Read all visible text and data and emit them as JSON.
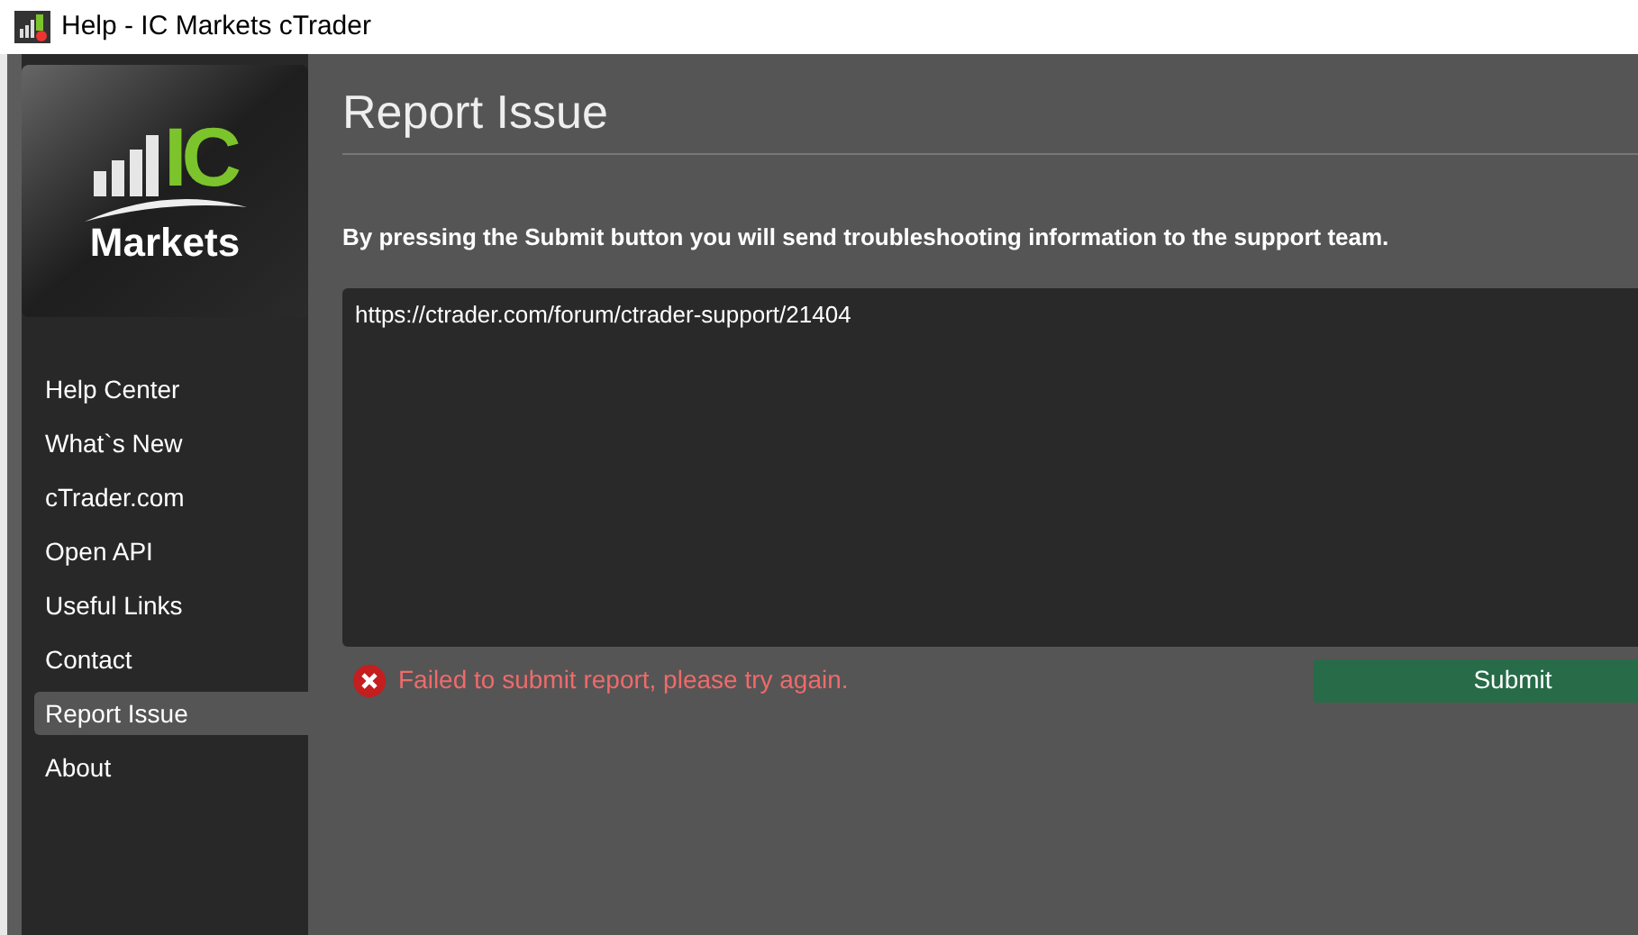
{
  "window": {
    "title": "Help - IC Markets cTrader"
  },
  "logo": {
    "brand_top": "IC",
    "brand_bottom": "Markets"
  },
  "sidebar": {
    "items": [
      {
        "label": "Help Center",
        "selected": false
      },
      {
        "label": "What`s New",
        "selected": false
      },
      {
        "label": "cTrader.com",
        "selected": false
      },
      {
        "label": "Open API",
        "selected": false
      },
      {
        "label": "Useful Links",
        "selected": false
      },
      {
        "label": "Contact",
        "selected": false
      },
      {
        "label": "Report Issue",
        "selected": true
      },
      {
        "label": "About",
        "selected": false
      }
    ]
  },
  "page": {
    "heading": "Report Issue",
    "instruction": "By pressing the Submit button you will send troubleshooting information to the support team.",
    "message": "https://ctrader.com/forum/ctrader-support/21404",
    "error": "Failed to submit report, please try again.",
    "submit": "Submit"
  }
}
